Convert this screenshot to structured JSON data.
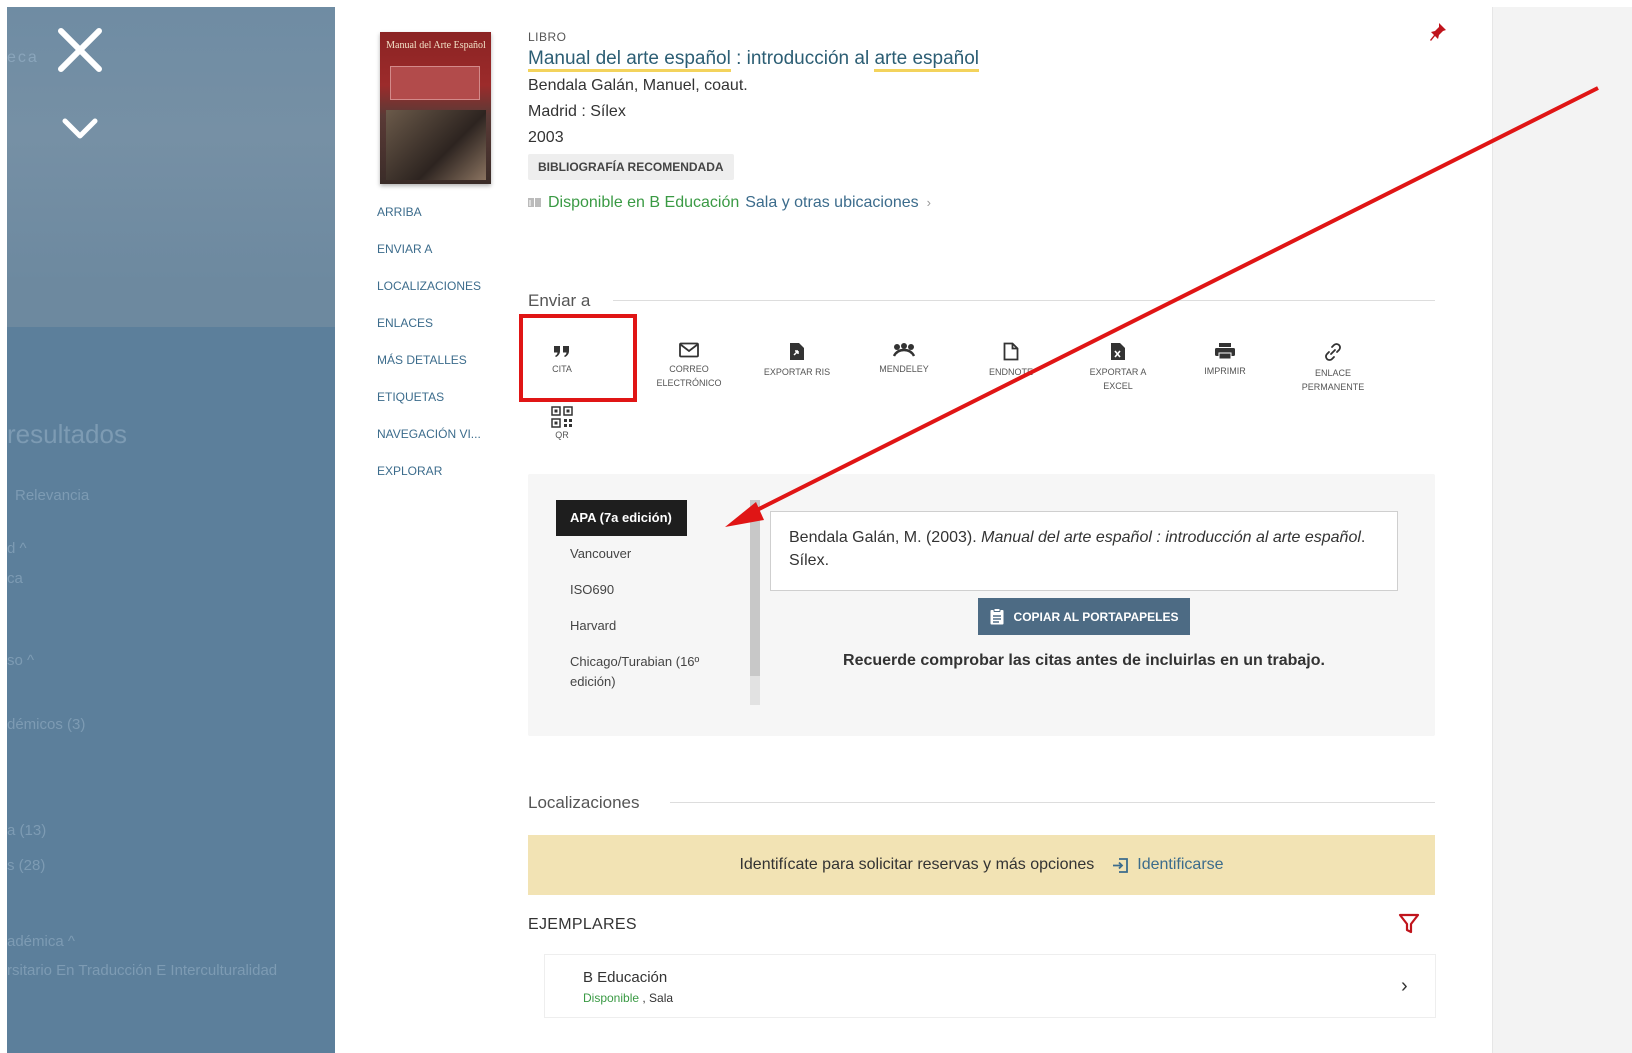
{
  "overlay": {
    "brand_fragment": "eca",
    "results_fragment": "resultados",
    "sort_fragment": "Relevancia",
    "facets": [
      "d ^",
      "ca",
      "so ^",
      "démicos (3)",
      "a (13)",
      "s (28)",
      "adémica ^",
      "rsitario En Traducción E Interculturalidad"
    ]
  },
  "record": {
    "type": "LIBRO",
    "title_part1": "Manual del arte español",
    "title_sep": " : introducción al ",
    "title_part2": "arte español",
    "author": "Bendala Galán, Manuel, coaut.",
    "publisher": "Madrid : Sílex",
    "year": "2003",
    "badge": "BIBLIOGRAFÍA RECOMENDADA",
    "availability_status": "Disponible en B Educación",
    "availability_location": "Sala y otras ubicaciones",
    "availability_chevron": "›",
    "cover_title": "Manual del Arte Español"
  },
  "sidenav": [
    "ARRIBA",
    "ENVIAR A",
    "LOCALIZACIONES",
    "ENLACES",
    "MÁS DETALLES",
    "ETIQUETAS",
    "NAVEGACIÓN VI...",
    "EXPLORAR"
  ],
  "send_to": {
    "title": "Enviar a",
    "actions": [
      {
        "label": "CITA",
        "icon": "quote-icon"
      },
      {
        "label": "CORREO ELECTRÓNICO",
        "icon": "mail-icon"
      },
      {
        "label": "EXPORTAR RIS",
        "icon": "file-export-icon"
      },
      {
        "label": "MENDELEY",
        "icon": "mendeley-icon"
      },
      {
        "label": "ENDNOTE",
        "icon": "document-icon"
      },
      {
        "label": "EXPORTAR A EXCEL",
        "icon": "excel-icon"
      },
      {
        "label": "IMPRIMIR",
        "icon": "print-icon"
      },
      {
        "label": "ENLACE PERMANENTE",
        "icon": "link-icon"
      },
      {
        "label": "QR",
        "icon": "qr-icon"
      }
    ]
  },
  "citation": {
    "styles": [
      "APA (7a edición)",
      "Vancouver",
      "ISO690",
      "Harvard",
      "Chicago/Turabian (16º edición)"
    ],
    "selected_style": "APA (7a edición)",
    "text_prefix": "Bendala Galán, M. (2003). ",
    "text_italic": "Manual del arte español : introducción al arte español",
    "text_suffix": ". Sílex.",
    "copy_button": "COPIAR AL PORTAPAPELES",
    "note": "Recuerde comprobar las citas antes de incluirlas en un trabajo."
  },
  "locations": {
    "title": "Localizaciones",
    "login_prompt": "Identifícate para solicitar reservas y más opciones",
    "login_link": "Identificarse",
    "items_header": "EJEMPLARES",
    "holdings": [
      {
        "library": "B Educación",
        "status": "Disponible",
        "location": " , Sala"
      }
    ]
  },
  "colors": {
    "accent": "#3c6c8c",
    "available": "#3a9a44",
    "annotation_red": "#e01515",
    "overlay": "#5c7f9b",
    "highlight": "#f3d35c"
  }
}
